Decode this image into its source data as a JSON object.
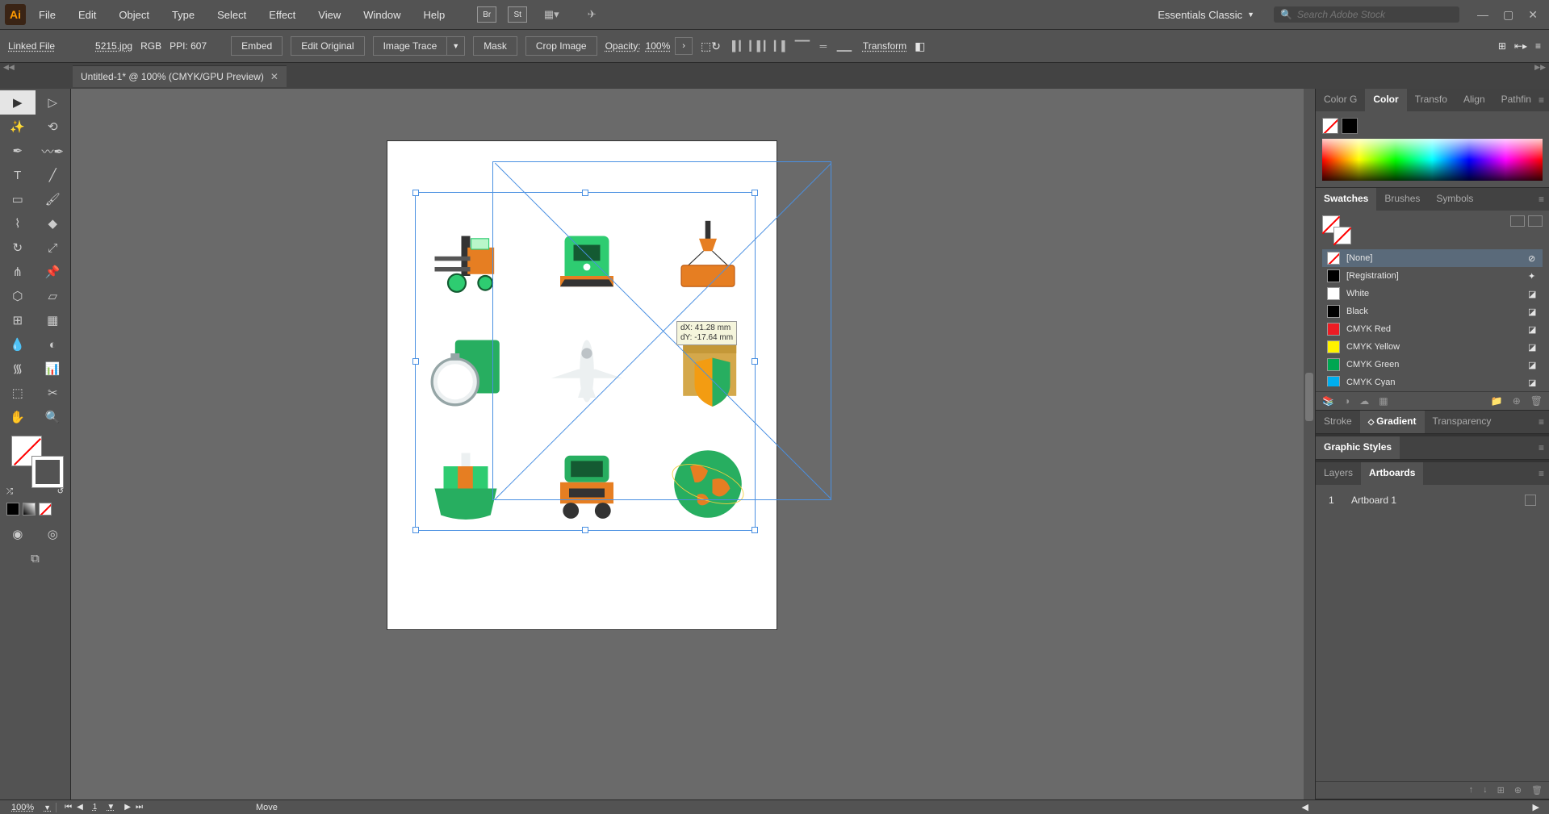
{
  "app": {
    "logo_text": "Ai"
  },
  "menu": {
    "file": "File",
    "edit": "Edit",
    "object": "Object",
    "type": "Type",
    "select": "Select",
    "effect": "Effect",
    "view": "View",
    "window": "Window",
    "help": "Help"
  },
  "top": {
    "workspace": "Essentials Classic",
    "search_placeholder": "Search Adobe Stock"
  },
  "control": {
    "link_label": "Linked File",
    "filename": "5215.jpg",
    "colormode": "RGB",
    "ppi_label": "PPI:",
    "ppi": "607",
    "embed": "Embed",
    "edit_original": "Edit Original",
    "image_trace": "Image Trace",
    "mask": "Mask",
    "crop": "Crop Image",
    "opacity_label": "Opacity:",
    "opacity": "100%",
    "transform": "Transform"
  },
  "tab": {
    "title": "Untitled-1* @ 100% (CMYK/GPU Preview)"
  },
  "tooltip": {
    "dx": "dX: 41.28 mm",
    "dy": "dY: -17.64 mm"
  },
  "statusbar": {
    "zoom": "100%",
    "artnav": "1",
    "tool": "Move"
  },
  "panels": {
    "color": {
      "t1": "Color G",
      "t2": "Color",
      "t3": "Transfo",
      "t4": "Align",
      "t5": "Pathfin"
    },
    "swatches": {
      "t1": "Swatches",
      "t2": "Brushes",
      "t3": "Symbols",
      "items": [
        {
          "name": "[None]",
          "color": "none"
        },
        {
          "name": "[Registration]",
          "color": "#000"
        },
        {
          "name": "White",
          "color": "#fff"
        },
        {
          "name": "Black",
          "color": "#000"
        },
        {
          "name": "CMYK Red",
          "color": "#ed1c24"
        },
        {
          "name": "CMYK Yellow",
          "color": "#fff200"
        },
        {
          "name": "CMYK Green",
          "color": "#00a651"
        },
        {
          "name": "CMYK Cyan",
          "color": "#00aeef"
        }
      ]
    },
    "gradient": {
      "t1": "Stroke",
      "t2": "Gradient",
      "t3": "Transparency"
    },
    "graphic": {
      "t1": "Graphic Styles"
    },
    "layers": {
      "t1": "Layers",
      "t2": "Artboards",
      "artboard_num": "1",
      "artboard_name": "Artboard 1"
    }
  }
}
